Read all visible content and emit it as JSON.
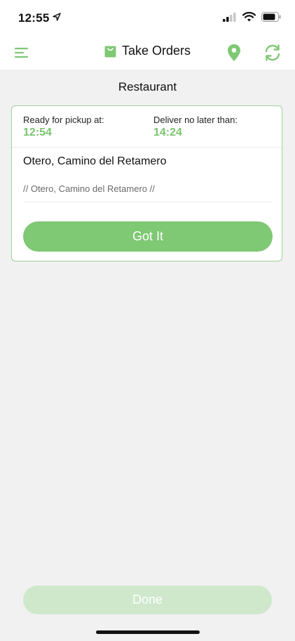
{
  "status_bar": {
    "time": "12:55"
  },
  "header": {
    "title": "Take Orders"
  },
  "section": {
    "title": "Restaurant"
  },
  "order": {
    "pickup_label": "Ready for pickup at:",
    "pickup_time": "12:54",
    "deliver_label": "Deliver no later than:",
    "deliver_time": "14:24",
    "address": "Otero, Camino del Retamero",
    "note": "// Otero, Camino del Retamero //",
    "confirm_label": "Got It"
  },
  "footer": {
    "done_label": "Done"
  },
  "colors": {
    "accent": "#7fc874",
    "accent_disabled": "#cfe8cc",
    "background": "#f1f1f1"
  },
  "icons": {
    "menu": "hamburger-menu-icon",
    "title": "shopping-bag-icon",
    "location": "location-pin-icon",
    "refresh": "refresh-icon"
  }
}
